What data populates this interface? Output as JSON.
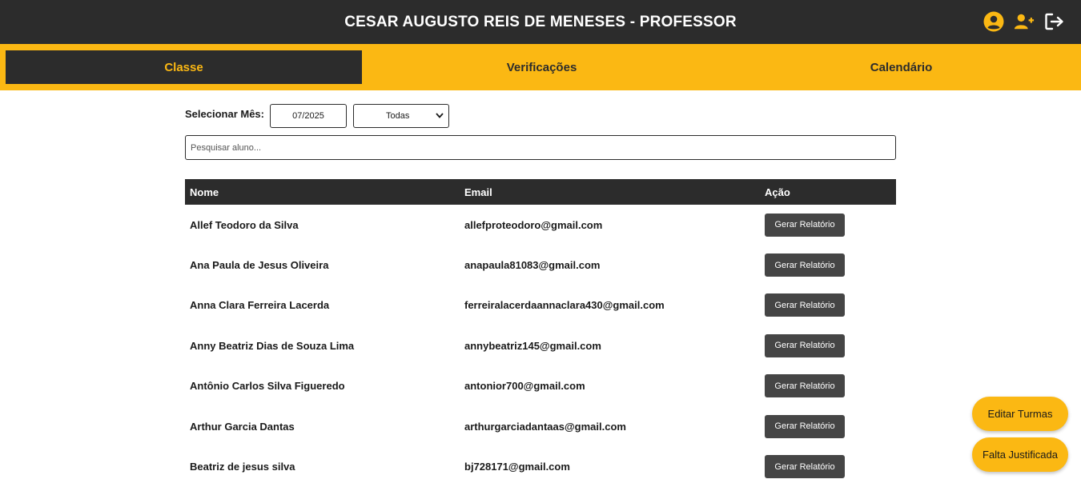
{
  "header": {
    "title": "CESAR AUGUSTO REIS DE MENESES - PROFESSOR",
    "icons": [
      "user-circle-icon",
      "user-plus-icon",
      "logout-icon"
    ],
    "accent": "#fbb813",
    "bg": "#2c2c2c"
  },
  "tabs": [
    {
      "label": "Classe",
      "active": true
    },
    {
      "label": "Verificações",
      "active": false
    },
    {
      "label": "Calendário",
      "active": false
    }
  ],
  "filters": {
    "month_label": "Selecionar Mês:",
    "month_value": "07/2025",
    "status_value": "Todas"
  },
  "search": {
    "placeholder": "Pesquisar aluno..."
  },
  "table": {
    "headers": [
      "Nome",
      "Email",
      "Ação"
    ],
    "action_label": "Gerar Relatório",
    "rows": [
      {
        "name": "Allef Teodoro da Silva",
        "email": "allefproteodoro@gmail.com"
      },
      {
        "name": "Ana Paula de Jesus Oliveira",
        "email": "anapaula81083@gmail.com"
      },
      {
        "name": "Anna Clara Ferreira Lacerda",
        "email": "ferreiralacerdaannaclara430@gmail.com"
      },
      {
        "name": "Anny Beatriz Dias de Souza Lima",
        "email": "annybeatriz145@gmail.com"
      },
      {
        "name": "Antônio Carlos Silva Figueredo",
        "email": "antonior700@gmail.com"
      },
      {
        "name": "Arthur Garcia Dantas",
        "email": "arthurgarciadantaas@gmail.com"
      },
      {
        "name": "Beatriz de jesus silva",
        "email": "bj728171@gmail.com"
      }
    ]
  },
  "floating_buttons": {
    "edit_classes": "Editar Turmas",
    "justified_absence": "Falta Justificada"
  }
}
